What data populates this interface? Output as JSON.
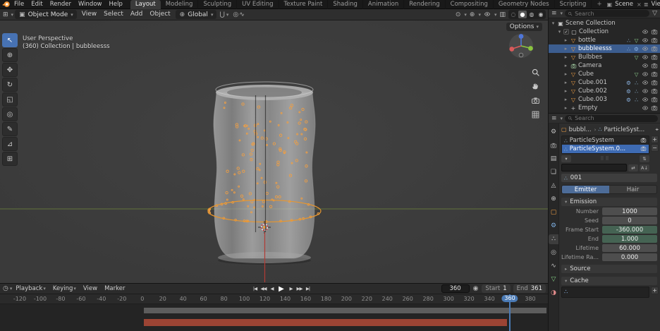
{
  "topbar": {
    "menus": [
      "File",
      "Edit",
      "Render",
      "Window",
      "Help"
    ],
    "workspaces": [
      "Layout",
      "Modeling",
      "Sculpting",
      "UV Editing",
      "Texture Paint",
      "Shading",
      "Animation",
      "Rendering",
      "Compositing",
      "Geometry Nodes",
      "Scripting"
    ],
    "active_workspace": "Layout",
    "new_workspace": "+",
    "scene": {
      "label": "Scene"
    },
    "viewlayer": {
      "label": "ViewLayer"
    }
  },
  "viewport": {
    "header": {
      "mode": "Object Mode",
      "menus": [
        "View",
        "Select",
        "Add",
        "Object"
      ],
      "orientation": "Global",
      "options": "Options"
    },
    "overlay": {
      "line1": "User Perspective",
      "line2": "(360) Collection | bubbleesss"
    },
    "tools": [
      "select-box",
      "cursor",
      "move",
      "rotate",
      "scale",
      "transform",
      "annotate",
      "measure",
      "add-cube"
    ],
    "active_tool": "select-box"
  },
  "outliner": {
    "search_placeholder": "Search",
    "rows": [
      {
        "label": "Scene Collection",
        "depth": 0,
        "icon": "scene-collection",
        "disclosure": "▾",
        "vis": false
      },
      {
        "label": "Collection",
        "depth": 1,
        "icon": "collection",
        "disclosure": "▾",
        "checkbox": true,
        "vis": true
      },
      {
        "label": "bottle",
        "depth": 2,
        "icon": "mesh",
        "disclosure": "▸",
        "extras": [
          "particles",
          "mesh-data"
        ],
        "vis": true
      },
      {
        "label": "bubbleesss",
        "depth": 2,
        "icon": "mesh",
        "disclosure": "▸",
        "extras": [
          "particles",
          "modifier"
        ],
        "selected": true,
        "vis": true
      },
      {
        "label": "Bulbbes",
        "depth": 2,
        "icon": "mesh",
        "disclosure": "▸",
        "extras": [
          "mesh-data"
        ],
        "vis": true
      },
      {
        "label": "Camera",
        "depth": 2,
        "icon": "camera-obj",
        "disclosure": "▸",
        "extras": [],
        "vis": true
      },
      {
        "label": "Cube",
        "depth": 2,
        "icon": "mesh",
        "disclosure": "▸",
        "extras": [
          "mesh-data"
        ],
        "vis": true
      },
      {
        "label": "Cube.001",
        "depth": 2,
        "icon": "mesh",
        "disclosure": "▸",
        "extras": [
          "modifier",
          "particles"
        ],
        "vis": true
      },
      {
        "label": "Cube.002",
        "depth": 2,
        "icon": "mesh",
        "disclosure": "▸",
        "extras": [
          "modifier",
          "particles"
        ],
        "vis": true
      },
      {
        "label": "Cube.003",
        "depth": 2,
        "icon": "mesh",
        "disclosure": "▸",
        "extras": [
          "modifier",
          "particles"
        ],
        "vis": true
      },
      {
        "label": "Empty",
        "depth": 2,
        "icon": "empty",
        "disclosure": "▸",
        "extras": [],
        "vis": true
      }
    ]
  },
  "properties": {
    "search_placeholder": "Search",
    "breadcrumb": {
      "object": "bubbl...",
      "data": "ParticleSyst..."
    },
    "tabs": [
      "tool",
      "render",
      "output",
      "view-layer",
      "scene",
      "world",
      "object",
      "modifiers",
      "particles",
      "physics",
      "constraints",
      "object-data",
      "material"
    ],
    "active_tab": "particles",
    "list": [
      {
        "name": "ParticleSystem"
      },
      {
        "name": "ParticleSystem.0...",
        "selected": true
      }
    ],
    "settings_name": "001",
    "type_toggle": {
      "emitter": "Emitter",
      "hair": "Hair",
      "active": "Emitter"
    },
    "panels": {
      "emission": {
        "title": "Emission",
        "rows": [
          {
            "label": "Number",
            "value": "1000"
          },
          {
            "label": "Seed",
            "value": "0"
          },
          {
            "label": "Frame Start",
            "value": "-360.000",
            "animated": true
          },
          {
            "label": "End",
            "value": "1.000",
            "animated": true
          },
          {
            "label": "Lifetime",
            "value": "60.000"
          },
          {
            "label": "Lifetime Ra...",
            "value": "0.000"
          }
        ]
      },
      "source": {
        "title": "Source"
      },
      "cache": {
        "title": "Cache"
      }
    }
  },
  "timeline": {
    "menus": [
      "Playback",
      "Keying",
      "View",
      "Marker"
    ],
    "transport": [
      {
        "name": "jump-to-start",
        "glyph": "|◀"
      },
      {
        "name": "prev-keyframe",
        "glyph": "◀◀"
      },
      {
        "name": "prev-frame",
        "glyph": "◀"
      },
      {
        "name": "play",
        "glyph": "▶"
      },
      {
        "name": "next-frame",
        "glyph": "▶"
      },
      {
        "name": "next-keyframe",
        "glyph": "▶▶"
      },
      {
        "name": "jump-to-end",
        "glyph": "▶|"
      }
    ],
    "current_frame": "360",
    "start": {
      "label": "Start",
      "value": "1"
    },
    "end": {
      "label": "End",
      "value": "361"
    },
    "ticks": [
      "-120",
      "-100",
      "-80",
      "-60",
      "-40",
      "-20",
      "0",
      "20",
      "40",
      "60",
      "80",
      "100",
      "120",
      "140",
      "160",
      "180",
      "200",
      "220",
      "240",
      "260",
      "280",
      "300",
      "320",
      "340",
      "360",
      "380"
    ],
    "current_tick": "360"
  },
  "colors": {
    "accent": "#4772b3",
    "object_orange": "#ed9e45",
    "cache_red": "#9c4434",
    "axis_green": "#6a7d3c"
  }
}
